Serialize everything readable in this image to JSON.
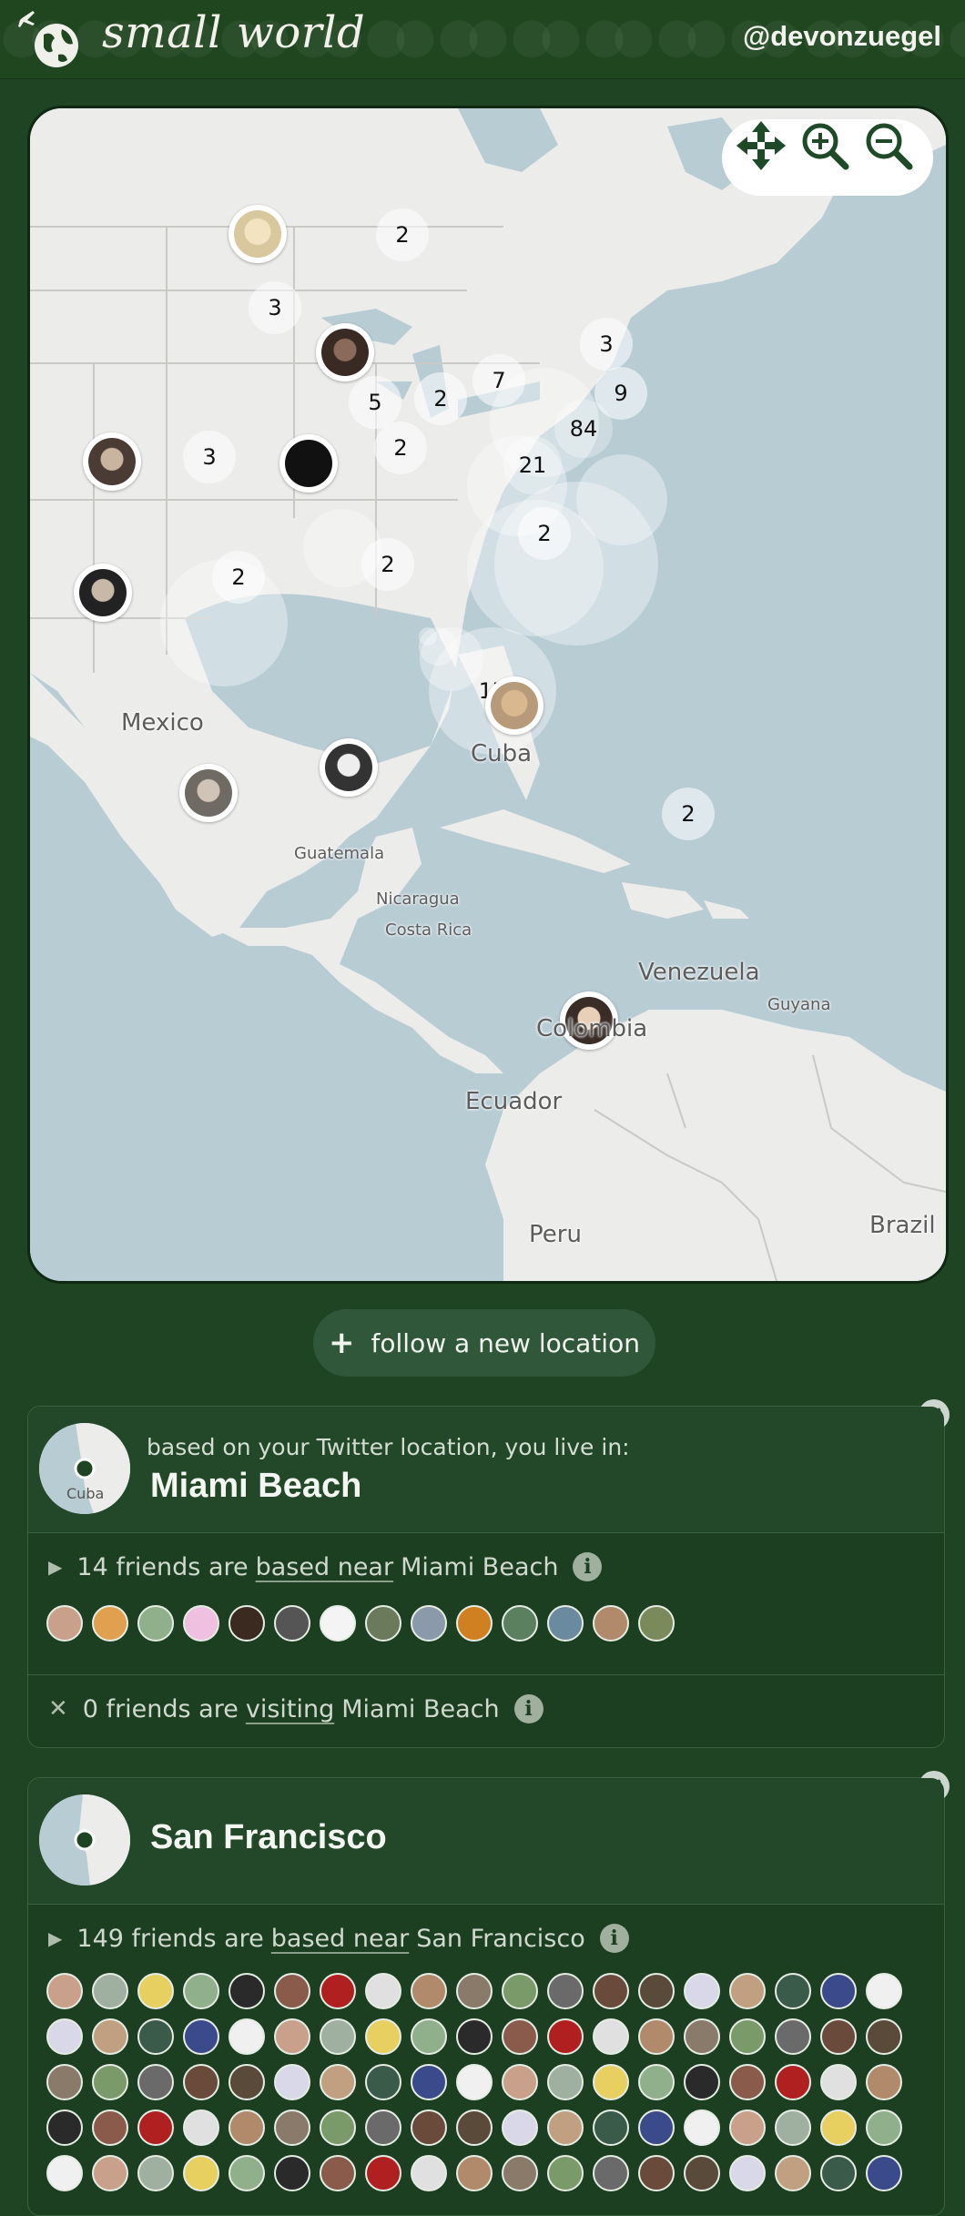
{
  "app": {
    "title": "small world",
    "user_handle": "@devonzuegel"
  },
  "map": {
    "cluster_counts": [
      "2",
      "3",
      "3",
      "5",
      "2",
      "7",
      "9",
      "84",
      "21",
      "2",
      "3",
      "2",
      "2",
      "2",
      "17",
      "2"
    ],
    "place_labels": {
      "mexico": "Mexico",
      "cuba": "Cuba",
      "guatemala": "Guatemala",
      "nicaragua": "Nicaragua",
      "costa_rica": "Costa Rica",
      "venezuela": "Venezuela",
      "guyana": "Guyana",
      "colombia": "Colombia",
      "ecuador": "Ecuador",
      "peru": "Peru",
      "brazil": "Brazil"
    },
    "controls": [
      "move-icon",
      "zoom-in-icon",
      "zoom-out-icon"
    ]
  },
  "follow_button": {
    "label": "follow a new location"
  },
  "cards": [
    {
      "subtitle": "based on your Twitter location, you live in:",
      "title": "Miami Beach",
      "map_label": "Cuba",
      "based_prefix": "14 friends are",
      "based_link": "based near",
      "based_place": "Miami Beach",
      "visiting_prefix": "0 friends are",
      "visiting_link": "visiting",
      "visiting_place": "Miami Beach",
      "avatar_count": 14
    },
    {
      "subtitle": "",
      "title": "San Francisco",
      "based_prefix": "149 friends are",
      "based_link": "based near",
      "based_place": "San Francisco"
    }
  ],
  "colors": {
    "background": "#1f4424",
    "card": "#1c3f21",
    "water": "#b8ccd4",
    "land": "#ececea"
  }
}
